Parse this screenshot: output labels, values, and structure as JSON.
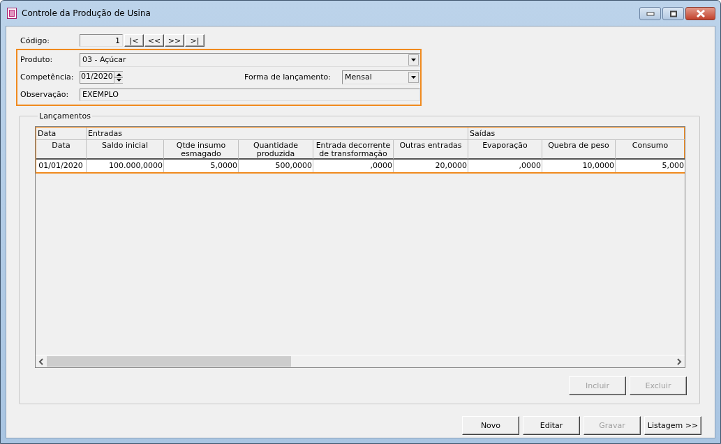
{
  "window": {
    "title": "Controle da Produção de Usina"
  },
  "form": {
    "codigo": {
      "label": "Código:",
      "value": "1"
    },
    "nav_buttons": [
      "|<",
      "<<",
      ">>",
      ">|"
    ],
    "produto": {
      "label": "Produto:",
      "value": "03 - Açúcar"
    },
    "competencia": {
      "label": "Competência:",
      "value": "01/2020"
    },
    "forma": {
      "label": "Forma de lançamento:",
      "value": "Mensal"
    },
    "observacao": {
      "label": "Observação:",
      "value": "EXEMPLO"
    }
  },
  "lancamentos": {
    "title": "Lançamentos",
    "groups": [
      {
        "label": "Data",
        "columns": [
          "Data"
        ]
      },
      {
        "label": "Entradas",
        "columns": [
          "Saldo inicial",
          "Qtde insumo esmagado",
          "Quantidade produzida",
          "Entrada decorrente de transformação",
          "Outras entradas"
        ]
      },
      {
        "label": "Saídas",
        "columns": [
          "Evaporação",
          "Quebra de peso",
          "Consumo"
        ]
      }
    ],
    "rows": [
      [
        "01/01/2020",
        "100.000,0000",
        "5,0000",
        "500,0000",
        ",0000",
        "20,0000",
        ",0000",
        "10,0000",
        "5,000"
      ]
    ],
    "buttons": [
      {
        "label": "Incluir",
        "disabled": true
      },
      {
        "label": "Excluir",
        "disabled": true
      }
    ]
  },
  "buttons": [
    {
      "label": "Novo",
      "disabled": false
    },
    {
      "label": "Editar",
      "disabled": false
    },
    {
      "label": "Gravar",
      "disabled": true
    },
    {
      "label": "Listagem >>",
      "disabled": false
    }
  ]
}
